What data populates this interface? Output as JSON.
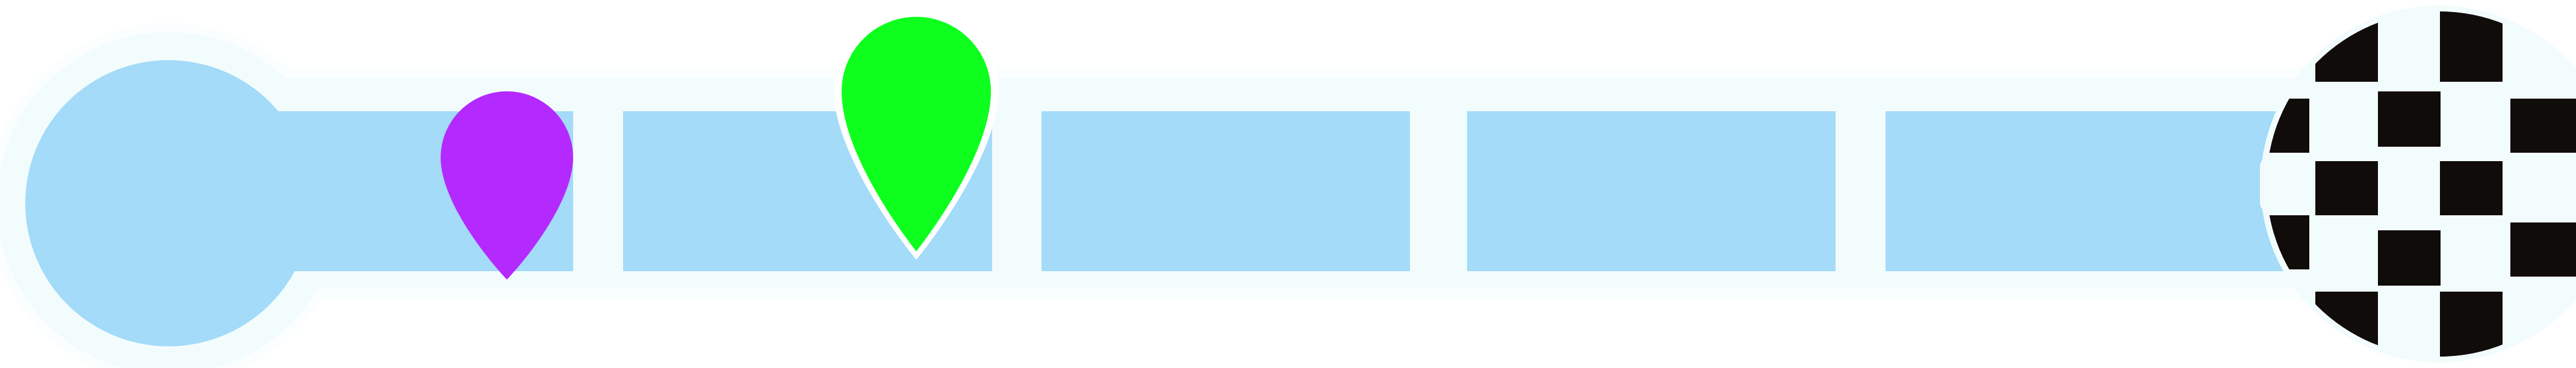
{
  "progress_track": {
    "segments_total": 5,
    "colors": {
      "frame": "#F3FCFD",
      "frame_outer": "#FBFEFE",
      "segment": "#A3DBF9",
      "start_circle": "#A3DBF9",
      "finish_dark": "#100C09",
      "finish_light": "#F3FCFD"
    },
    "start_marker": {
      "icon": "start-circle-icon"
    },
    "finish_marker": {
      "icon": "checkered-flag-icon"
    }
  },
  "players": [
    {
      "name": "purple",
      "icon": "map-pin-icon",
      "color": "#B429FE",
      "progress": 0.12
    },
    {
      "name": "green",
      "icon": "map-pin-icon",
      "color": "#0EFF1E",
      "progress": 0.33
    }
  ]
}
